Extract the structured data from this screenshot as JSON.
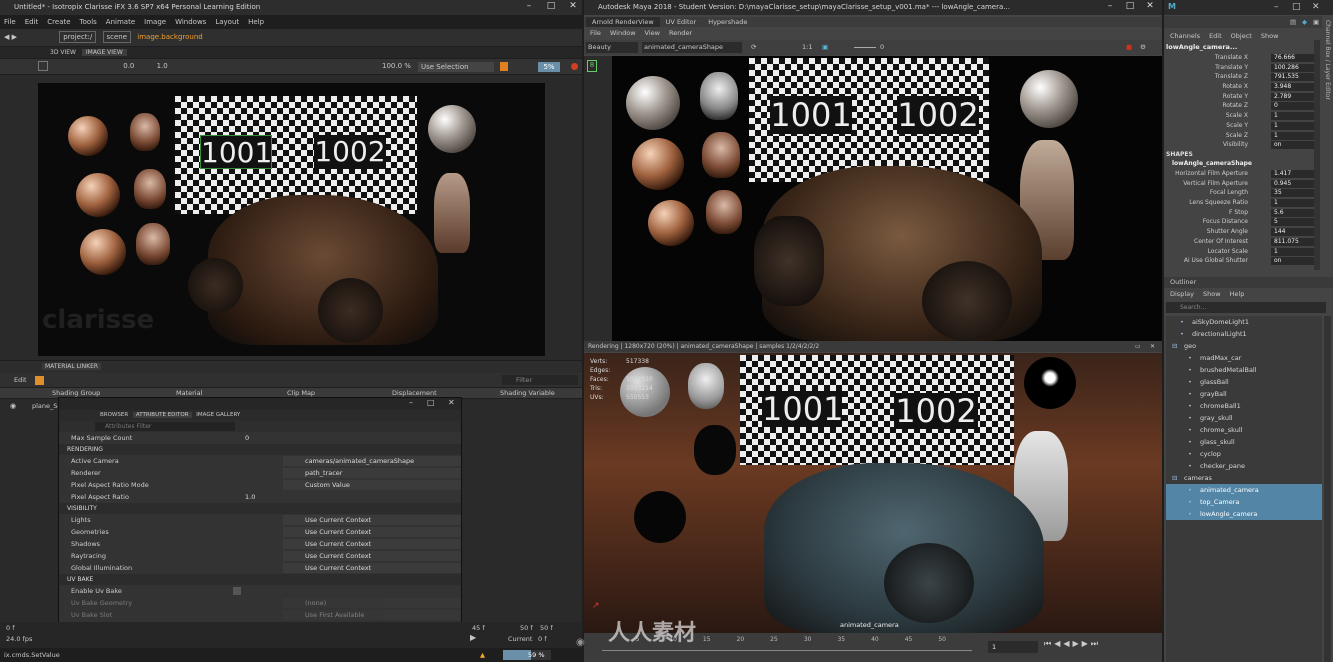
{
  "clarisse": {
    "title": "Untitled* - Isotropix Clarisse iFX 3.6 SP7 x64 Personal Learning Edition",
    "menu": [
      "File",
      "Edit",
      "Create",
      "Tools",
      "Animate",
      "Image",
      "Windows",
      "Layout",
      "Help"
    ],
    "path": [
      "project:/",
      "scene",
      "image.background"
    ],
    "view_tabs": [
      "3D VIEW",
      "IMAGE VIEW"
    ],
    "toolbar": {
      "exposure": "0.0",
      "gamma": "1.0",
      "zoom": "100.0 %",
      "selection": "Use Selection",
      "sampling": "5%"
    },
    "watermark": "clarisse",
    "udims": [
      "1001",
      "1002"
    ],
    "material_linker": {
      "tab": "MATERIAL LINKER",
      "edit": "Edit",
      "filter": "Filter",
      "columns": [
        "Shading Group",
        "Material",
        "Clip Map",
        "Displacement",
        "Shading Variable"
      ],
      "row_label": "plane_Sc"
    },
    "attr_editor": {
      "tabs": [
        "BROWSER",
        "ATTRIBUTE EDITOR",
        "IMAGE GALLERY"
      ],
      "filter": "Attributes Filter",
      "top_row": {
        "label": "Max Sample Count",
        "value": "0"
      },
      "sections": [
        {
          "name": "RENDERING",
          "rows": [
            {
              "label": "Active Camera",
              "value": "cameras/animated_cameraShape"
            },
            {
              "label": "Renderer",
              "value": "path_tracer"
            },
            {
              "label": "Pixel Aspect Ratio Mode",
              "value": "Custom Value"
            },
            {
              "label": "Pixel Aspect Ratio",
              "value": "1.0"
            }
          ]
        },
        {
          "name": "VISIBILITY",
          "rows": [
            {
              "label": "Lights",
              "value": "Use Current Context"
            },
            {
              "label": "Geometries",
              "value": "Use Current Context"
            },
            {
              "label": "Shadows",
              "value": "Use Current Context"
            },
            {
              "label": "Raytracing",
              "value": "Use Current Context"
            },
            {
              "label": "Global Illumination",
              "value": "Use Current Context"
            }
          ]
        },
        {
          "name": "UV BAKE",
          "rows": [
            {
              "label": "Enable Uv Bake",
              "value": ""
            },
            {
              "label": "Uv Bake Geometry",
              "value": "(none)"
            },
            {
              "label": "Uv Bake Slot",
              "value": "Use First Available"
            },
            {
              "label": "Uv Bake Range",
              "value": "0.0"
            }
          ]
        }
      ]
    },
    "timeline": {
      "start": "0 f",
      "fps": "24.0 fps",
      "frame_a": "45 f",
      "frame_b": "50 f",
      "end": "50 f",
      "current_label": "Current",
      "current": "0 f",
      "progress": "59 %"
    },
    "status": "ix.cmds.SetValue"
  },
  "maya": {
    "title": "Autodesk Maya 2018 - Student Version: D:\\mayaClarisse_setup\\mayaClarisse_setup_v001.ma* --- lowAngle_camera...",
    "tabs": [
      "Arnold RenderView",
      "UV Editor",
      "Hypershade"
    ],
    "menu": [
      "File",
      "Window",
      "View",
      "Render"
    ],
    "aov": "Beauty",
    "camera": "animated_cameraShape",
    "ratio": "1:1",
    "exposure": "0",
    "render_status": "Rendering | 1280x720 (20%) | animated_cameraShape | samples 1/2/4/2/2/2",
    "viewport_label": "animated_camera",
    "hud": [
      "Verts:",
      "Edges:",
      "Faces:",
      "Tris:",
      "UVs:"
    ],
    "hud_vals": [
      "517338",
      "",
      "1032310",
      "1033214",
      "550553"
    ],
    "timeline_ticks": [
      "5",
      "10",
      "15",
      "20",
      "25",
      "30",
      "35",
      "40",
      "45",
      "50"
    ],
    "frame": "1"
  },
  "channel_box": {
    "menu": [
      "Channels",
      "Edit",
      "Object",
      "Show"
    ],
    "object": "lowAngle_camera...",
    "channels": [
      {
        "label": "Translate X",
        "value": "76.666"
      },
      {
        "label": "Translate Y",
        "value": "100.286"
      },
      {
        "label": "Translate Z",
        "value": "791.535"
      },
      {
        "label": "Rotate X",
        "value": "3.948"
      },
      {
        "label": "Rotate Y",
        "value": "2.789"
      },
      {
        "label": "Rotate Z",
        "value": "0"
      },
      {
        "label": "Scale X",
        "value": "1"
      },
      {
        "label": "Scale Y",
        "value": "1"
      },
      {
        "label": "Scale Z",
        "value": "1"
      },
      {
        "label": "Visibility",
        "value": "on"
      }
    ],
    "shapes_label": "SHAPES",
    "shape_name": "lowAngle_cameraShape",
    "shape_attrs": [
      {
        "label": "Horizontal Film Aperture",
        "value": "1.417"
      },
      {
        "label": "Vertical Film Aperture",
        "value": "0.945"
      },
      {
        "label": "Focal Length",
        "value": "35"
      },
      {
        "label": "Lens Squeeze Ratio",
        "value": "1"
      },
      {
        "label": "F Stop",
        "value": "5.6"
      },
      {
        "label": "Focus Distance",
        "value": "5"
      },
      {
        "label": "Shutter Angle",
        "value": "144"
      },
      {
        "label": "Center Of Interest",
        "value": "811.075"
      },
      {
        "label": "Locator Scale",
        "value": "1"
      },
      {
        "label": "Ai Use Global Shutter",
        "value": "on"
      }
    ],
    "side_tab": "Channel Box / Layer Editor"
  },
  "outliner": {
    "title": "Outliner",
    "menu": [
      "Display",
      "Show",
      "Help"
    ],
    "search": "Search...",
    "items": [
      {
        "label": "aiSkyDomeLight1",
        "indent": 1,
        "sel": false
      },
      {
        "label": "directionalLight1",
        "indent": 1,
        "sel": false
      },
      {
        "label": "geo",
        "indent": 0,
        "sel": false
      },
      {
        "label": "madMax_car",
        "indent": 2,
        "sel": false
      },
      {
        "label": "brushedMetalBall",
        "indent": 2,
        "sel": false
      },
      {
        "label": "glassBall",
        "indent": 2,
        "sel": false
      },
      {
        "label": "grayBall",
        "indent": 2,
        "sel": false
      },
      {
        "label": "chromeBall1",
        "indent": 2,
        "sel": false
      },
      {
        "label": "gray_skull",
        "indent": 2,
        "sel": false
      },
      {
        "label": "chrome_skull",
        "indent": 2,
        "sel": false
      },
      {
        "label": "glass_skull",
        "indent": 2,
        "sel": false
      },
      {
        "label": "cyclop",
        "indent": 2,
        "sel": false
      },
      {
        "label": "checker_pane",
        "indent": 2,
        "sel": false
      },
      {
        "label": "cameras",
        "indent": 0,
        "sel": false
      },
      {
        "label": "animated_camera",
        "indent": 2,
        "sel": true
      },
      {
        "label": "top_Camera",
        "indent": 2,
        "sel": true
      },
      {
        "label": "lowAngle_camera",
        "indent": 2,
        "sel": true
      }
    ]
  },
  "watermark_cn": "人人素材"
}
